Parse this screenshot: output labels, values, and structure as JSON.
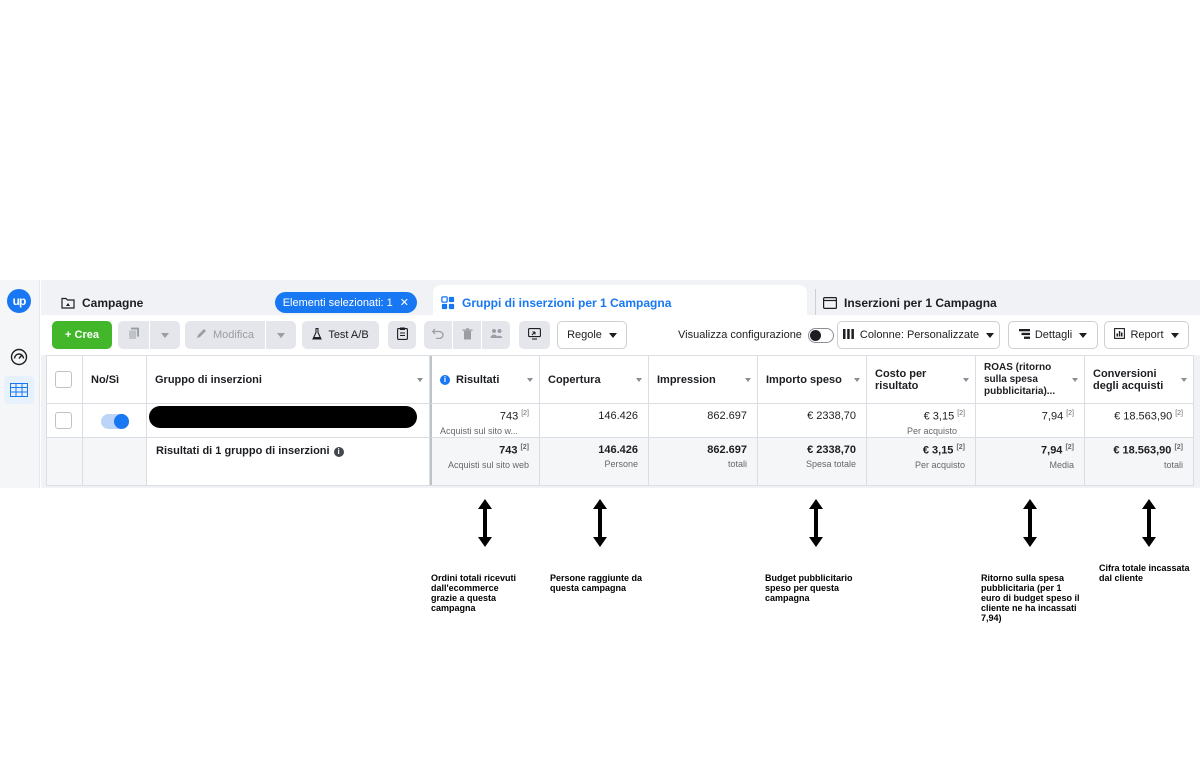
{
  "rail": {
    "logo_text": "up",
    "icons": [
      "gauge-icon",
      "table-grid-icon"
    ]
  },
  "tabs": {
    "campaigns": "Campagne",
    "selected_pill": "Elementi selezionati: 1",
    "adsets": "Gruppi di inserzioni per 1 Campagna",
    "ads": "Inserzioni per 1 Campagna"
  },
  "toolbar": {
    "create": "+ Crea",
    "edit": "Modifica",
    "ab_test": "Test A/B",
    "rules": "Regole",
    "view_config": "Visualizza configurazione",
    "columns": "Colonne: Personalizzate",
    "details": "Dettagli",
    "report": "Report"
  },
  "table": {
    "headers": {
      "onoff": "No/Sì",
      "name": "Gruppo di inserzioni",
      "results": "Risultati",
      "reach": "Copertura",
      "impressions": "Impression",
      "spend": "Importo speso",
      "cpr": "Costo per risultato",
      "roas": "ROAS (ritorno sulla spesa pubblicitaria)...",
      "conv": "Conversioni degli acquisti"
    },
    "row": {
      "results": "743",
      "results_sub": "Acquisti sul sito w...",
      "reach": "146.426",
      "impressions": "862.697",
      "spend": "€ 2338,70",
      "cpr": "€ 3,15",
      "cpr_sub": "Per acquisto",
      "roas": "7,94",
      "conv": "€ 18.563,90"
    },
    "total": {
      "label": "Risultati di 1 gruppo di inserzioni",
      "results": "743",
      "results_sub": "Acquisti sul sito web",
      "reach": "146.426",
      "reach_sub": "Persone",
      "impressions": "862.697",
      "impressions_sub": "totali",
      "spend": "€ 2338,70",
      "spend_sub": "Spesa totale",
      "cpr": "€ 3,15",
      "cpr_sub": "Per acquisto",
      "roas": "7,94",
      "roas_sub": "Media",
      "conv": "€ 18.563,90",
      "conv_sub": "totali"
    },
    "footnote_mark": "[2]"
  },
  "annotations": {
    "results": "Ordini totali ricevuti dall'ecommerce grazie a questa campagna",
    "reach": "Persone raggiunte da questa campagna",
    "spend": "Budget pubblicitario speso per questa campagna",
    "roas": "Ritorno sulla spesa pubblicitaria (per 1 euro di budget speso il cliente ne ha incassati 7,94)",
    "conv": "Cifra totale incassata dal cliente"
  },
  "colors": {
    "accent": "#1877f2",
    "create_green": "#42b72a"
  }
}
